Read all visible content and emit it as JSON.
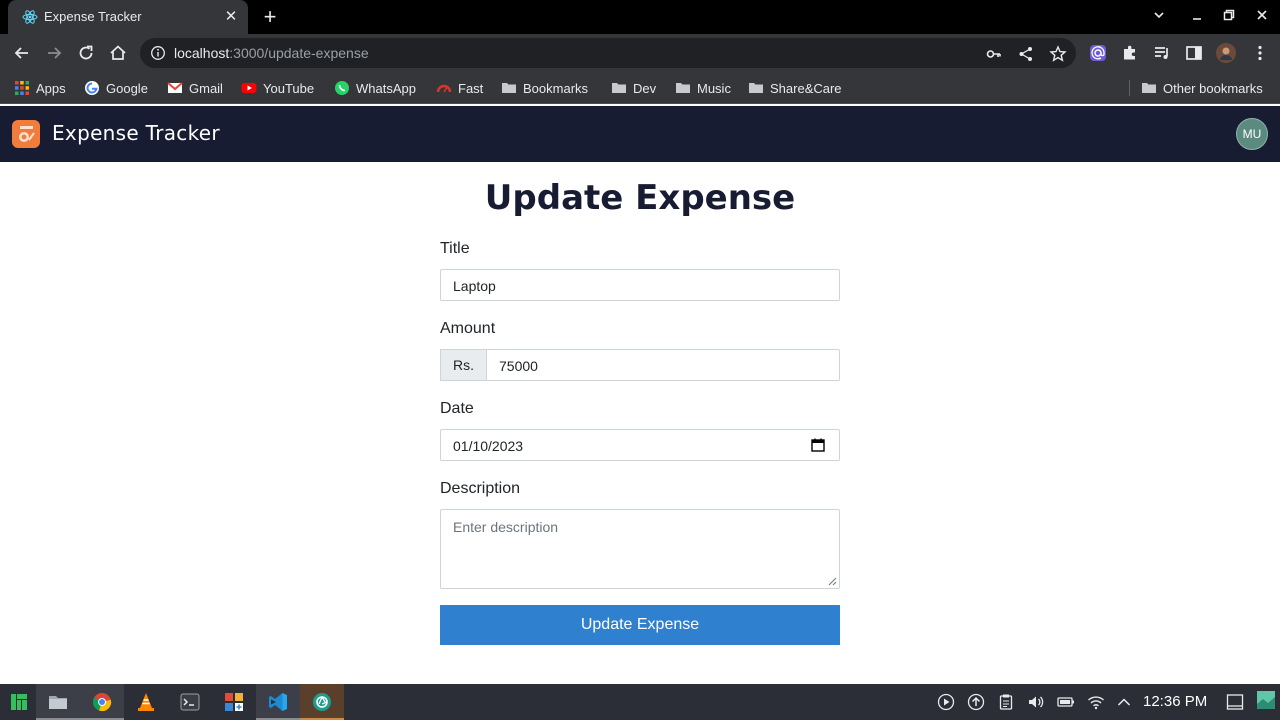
{
  "browser": {
    "tab_title": "Expense Tracker",
    "url_host": "localhost",
    "url_rest": ":3000/update-expense",
    "bookmarks": [
      "Apps",
      "Google",
      "Gmail",
      "YouTube",
      "WhatsApp",
      "Fast",
      "Bookmarks",
      "Dev",
      "Music",
      "Share&Care"
    ],
    "other_bookmarks": "Other bookmarks"
  },
  "app": {
    "brand": "Expense Tracker",
    "avatar_initials": "MU",
    "accent_color": "#2f80cf",
    "navbar_color": "#171c33"
  },
  "form": {
    "heading": "Update Expense",
    "title_label": "Title",
    "title_value": "Laptop",
    "amount_label": "Amount",
    "amount_prefix": "Rs.",
    "amount_value": "75000",
    "date_label": "Date",
    "date_value": "01/10/2023",
    "description_label": "Description",
    "description_placeholder": "Enter description",
    "submit_label": "Update Expense"
  },
  "taskbar": {
    "clock": "12:36 PM"
  }
}
